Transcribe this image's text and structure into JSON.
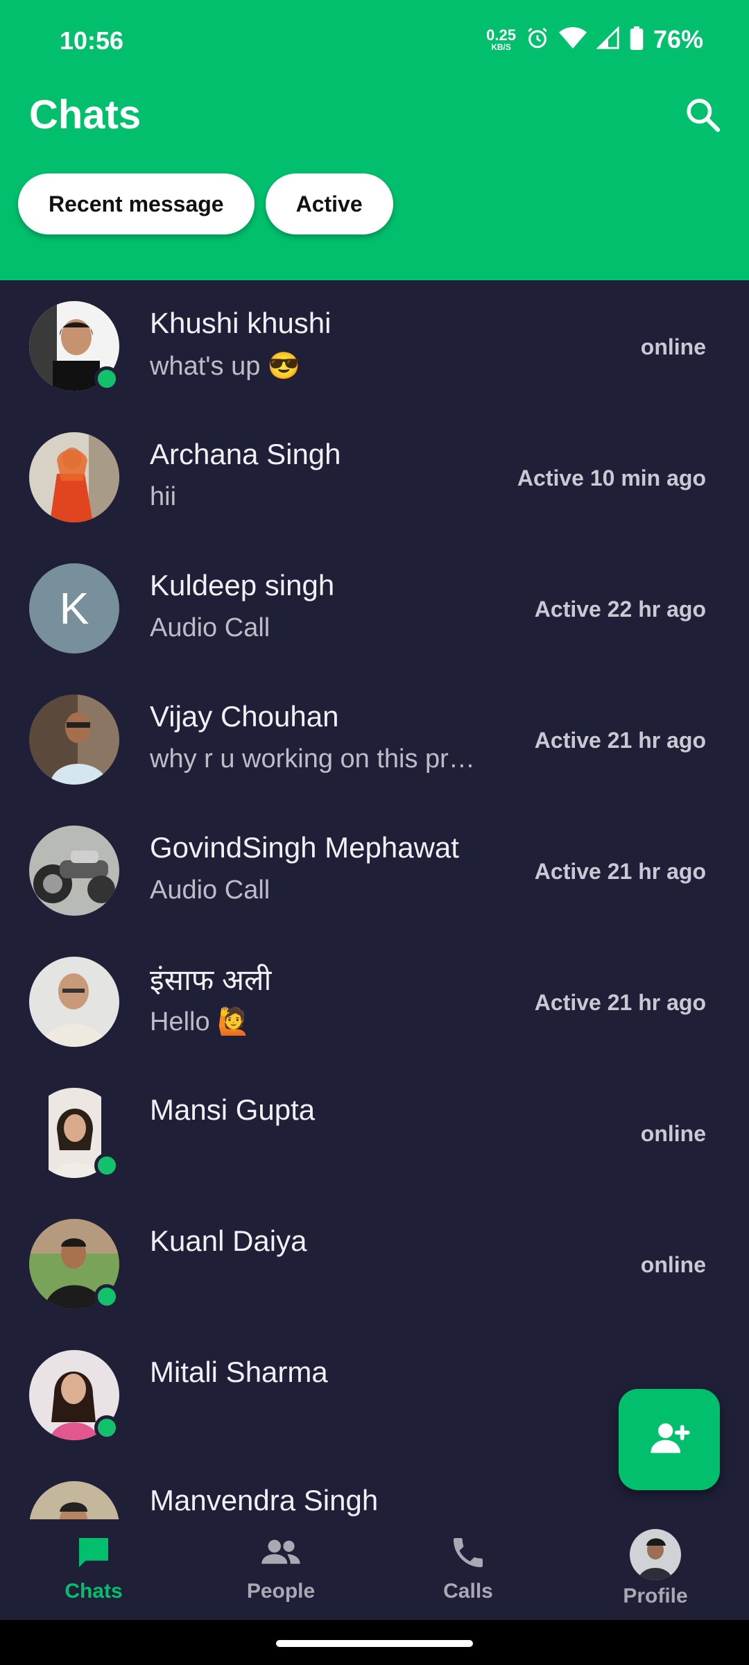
{
  "status_bar": {
    "time": "10:56",
    "net_speed_value": "0.25",
    "net_speed_unit": "KB/S",
    "battery": "76%"
  },
  "header": {
    "title": "Chats",
    "filters": [
      "Recent message",
      "Active"
    ]
  },
  "chats": [
    {
      "name": "Khushi khushi",
      "message": "what's up 😎",
      "status": "online"
    },
    {
      "name": "Archana Singh",
      "message": "hii",
      "status": "Active 10 min ago"
    },
    {
      "name": "Kuldeep singh",
      "message": "Audio Call",
      "status": "Active 22 hr ago",
      "avatar_letter": "K"
    },
    {
      "name": "Vijay Chouhan",
      "message": "why r u working on this pr…",
      "status": "Active 21 hr ago"
    },
    {
      "name": "GovindSingh Mephawat",
      "message": "Audio Call",
      "status": "Active 21 hr ago"
    },
    {
      "name": "इंसाफ अली",
      "message": "Hello 🙋",
      "status": "Active 21 hr ago"
    },
    {
      "name": "Mansi Gupta",
      "message": "",
      "status": "online"
    },
    {
      "name": "Kuanl Daiya",
      "message": "",
      "status": "online"
    },
    {
      "name": "Mitali Sharma",
      "message": "",
      "status": ""
    },
    {
      "name": "Manvendra Singh",
      "message": "",
      "status": ""
    }
  ],
  "bottom_nav": {
    "items": [
      {
        "label": "Chats",
        "icon": "chat-bubble-icon"
      },
      {
        "label": "People",
        "icon": "people-icon"
      },
      {
        "label": "Calls",
        "icon": "phone-icon"
      },
      {
        "label": "Profile",
        "icon": "profile-avatar"
      }
    ]
  },
  "colors": {
    "accent": "#01bf6c",
    "background": "#1f1f38",
    "online": "#13c16d"
  }
}
